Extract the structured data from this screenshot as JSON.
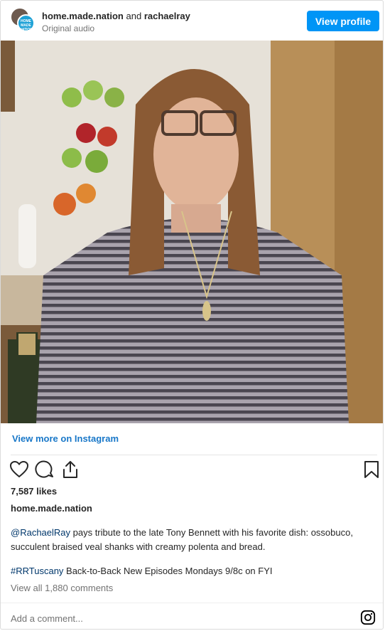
{
  "header": {
    "user1": "home.made.nation",
    "conjunction": "and",
    "user2": "rachaelray",
    "audio": "Original audio",
    "avatar_text": "HOME MADE NATION",
    "view_profile": "View profile"
  },
  "post": {
    "view_more": "View more on Instagram",
    "likes": "7,587 likes",
    "owner": "home.made.nation",
    "caption_mention": "@RachaelRay",
    "caption_text": " pays tribute to the late Tony Bennett with his favorite dish: ossobuco, succulent braised veal shanks with creamy polenta and bread.",
    "hashtag": "#RRTuscany",
    "caption2_text": " Back-to-Back New Episodes Mondays 9/8c on FYI",
    "view_comments": "View all 1,880 comments",
    "add_comment_placeholder": "Add a comment..."
  },
  "icons": {
    "like": "heart-icon",
    "comment": "comment-icon",
    "share": "share-icon",
    "save": "bookmark-icon",
    "instagram": "instagram-icon"
  },
  "colors": {
    "accent": "#0095f6",
    "link": "#00376b",
    "muted": "#737373"
  }
}
